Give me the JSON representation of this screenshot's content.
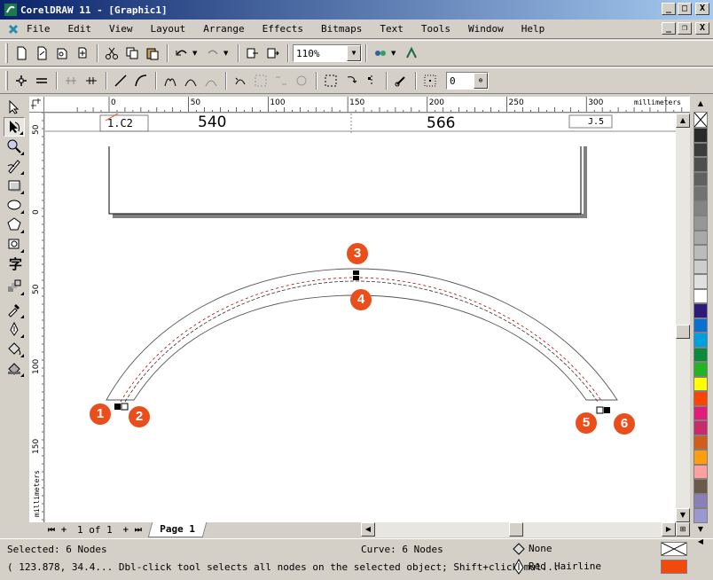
{
  "window": {
    "title": "CorelDRAW 11 - [Graphic1]",
    "buttons": {
      "minimize": "_",
      "maximize": "□",
      "close": "X"
    }
  },
  "menu": [
    {
      "label": "File",
      "mnemonic": "F"
    },
    {
      "label": "Edit",
      "mnemonic": "E"
    },
    {
      "label": "View",
      "mnemonic": "V"
    },
    {
      "label": "Layout",
      "mnemonic": "L"
    },
    {
      "label": "Arrange",
      "mnemonic": "A"
    },
    {
      "label": "Effects",
      "mnemonic": "c"
    },
    {
      "label": "Bitmaps",
      "mnemonic": "B"
    },
    {
      "label": "Text",
      "mnemonic": "T"
    },
    {
      "label": "Tools",
      "mnemonic": "o"
    },
    {
      "label": "Window",
      "mnemonic": "W"
    },
    {
      "label": "Help",
      "mnemonic": "H"
    }
  ],
  "toolbar": {
    "zoom": "110%",
    "nudge_value": "0"
  },
  "rulers": {
    "unit": "millimeters",
    "h_ticks": [
      "0",
      "50",
      "100",
      "150",
      "200",
      "250",
      "300"
    ],
    "v_ticks": [
      "50",
      "0",
      "50",
      "100",
      "150"
    ]
  },
  "drawing": {
    "label_left": "1.C2",
    "number_left": "540",
    "number_right": "566",
    "label_right": "J.5"
  },
  "markers": [
    "1",
    "2",
    "3",
    "4",
    "5",
    "6"
  ],
  "page_nav": {
    "page_of": "1 of 1",
    "page_tab": "Page 1"
  },
  "status": {
    "selected": "Selected: 6 Nodes",
    "curve": "Curve: 6 Nodes",
    "fill": "None",
    "hint": "( 123.878, 34.4... Dbl-click tool selects all nodes on the selected object; Shift+click mul...",
    "outline_color": "Red",
    "outline_width": "Hairline",
    "outline_hex": "#f24a0c"
  },
  "palette": [
    "#2a2a2a",
    "#3c3c3c",
    "#4e4e4e",
    "#606060",
    "#727272",
    "#848484",
    "#979797",
    "#a9a9a9",
    "#bbbbbb",
    "#cdcdcd",
    "#e0e0e0",
    "#ffffff",
    "#2e1a7a",
    "#0b6fd0",
    "#00a0e0",
    "#0a8a3a",
    "#21b521",
    "#ffff00",
    "#ff4400",
    "#e41b7a",
    "#c82a6a",
    "#d25c1a",
    "#ff9d0a",
    "#ff9f9f",
    "#6a5a4a",
    "#8a80b8",
    "#9a98d0"
  ]
}
